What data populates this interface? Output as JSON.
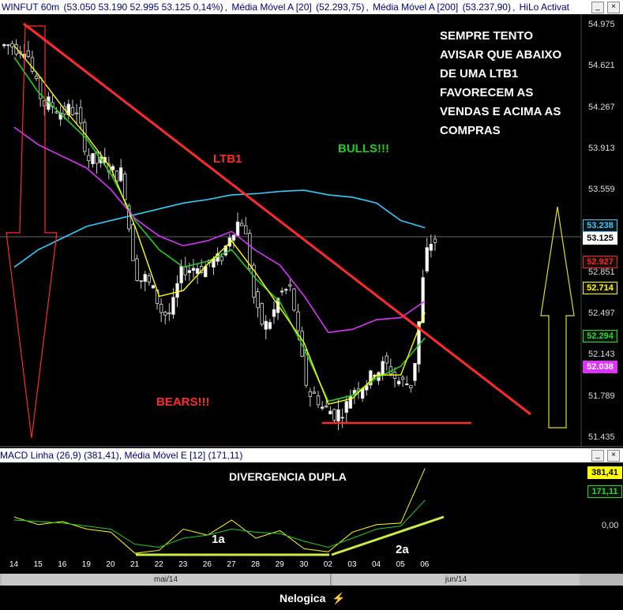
{
  "window": {
    "title_symbol": "WINFUT 60m",
    "title_values": "(53.050  53.190  52.995  53.125  0,14%)",
    "ma20_label": "Média Móvel A [20]",
    "ma20_value": "(52.293,75)",
    "ma200_label": "Média Móvel A [200]",
    "ma200_value": "(53.237,90)",
    "hilo_label": "HiLo Activat",
    "btn_min": "_",
    "btn_close": "×"
  },
  "sub_window": {
    "macd_label": "MACD Linha (26,9)",
    "macd_value": "(381,41)",
    "signal_label": "Média Móvel E [12]",
    "signal_value": "(171,11)",
    "btn_min": "_",
    "btn_close": "×"
  },
  "annotations": {
    "note": "SEMPRE TENTO AVISAR QUE ABAIXO DE UMA LTB1 FAVORECEM AS VENDAS E ACIMA AS COMPRAS",
    "ltb": "LTB1",
    "bulls": "BULLS!!!",
    "bears": "BEARS!!!",
    "divergence": "DIVERGENCIA DUPLA",
    "d1": "1a",
    "d2": "2a"
  },
  "price_axis": [
    "54.975",
    "54.621",
    "54.267",
    "53.913",
    "53.559",
    "52.851",
    "52.497",
    "52.143",
    "51.789",
    "51.435"
  ],
  "price_tags": [
    {
      "value": "53.238",
      "color": "#33ccff"
    },
    {
      "value": "53.125",
      "color": "#ffffff"
    },
    {
      "value": "52.927",
      "color": "#ff2020"
    },
    {
      "value": "52.714",
      "color": "#ffff00"
    },
    {
      "value": "52.294",
      "color": "#22dd22"
    },
    {
      "value": "52.038",
      "color": "#dd33ff"
    }
  ],
  "macd_axis": [
    "0,00"
  ],
  "macd_tags": [
    {
      "value": "381,41",
      "color": "#ffff00"
    },
    {
      "value": "171,11",
      "color": "#22dd22"
    }
  ],
  "x_labels": [
    "14",
    "15",
    "16",
    "19",
    "20",
    "21",
    "22",
    "23",
    "26",
    "27",
    "28",
    "29",
    "30",
    "02",
    "03",
    "04",
    "05",
    "06"
  ],
  "month_labels": [
    "mai/14",
    "jun/14"
  ],
  "footer": {
    "brand": "Nelogica"
  },
  "chart_data": [
    {
      "type": "candlestick",
      "title": "WINFUT 60m",
      "ylim": [
        51435,
        54975
      ],
      "y_ticks": [
        54975,
        54621,
        54267,
        53913,
        53559,
        52851,
        52497,
        52143,
        51789,
        51435
      ],
      "categories": [
        "14",
        "15",
        "16",
        "19",
        "20",
        "21",
        "22",
        "23",
        "26",
        "27",
        "28",
        "29",
        "30",
        "02",
        "03",
        "04",
        "05",
        "06"
      ],
      "series": [
        {
          "name": "Média Móvel A [20]",
          "values": [
            54700,
            54400,
            54200,
            54000,
            53700,
            53300,
            53050,
            52900,
            52950,
            53050,
            52800,
            52600,
            52200,
            51750,
            51800,
            51950,
            52050,
            52294
          ]
        },
        {
          "name": "Média Móvel A [200]",
          "values": [
            52900,
            53050,
            53150,
            53250,
            53300,
            53350,
            53400,
            53450,
            53480,
            53520,
            53530,
            53550,
            53560,
            53520,
            53500,
            53450,
            53300,
            53238
          ]
        },
        {
          "name": "Close",
          "values": [
            54800,
            54300,
            54250,
            53800,
            53700,
            52800,
            52500,
            52900,
            52950,
            53300,
            52400,
            52700,
            51800,
            51650,
            51900,
            52050,
            51900,
            53125
          ]
        }
      ],
      "last": {
        "open": 53050,
        "high": 53190,
        "low": 52995,
        "close": 53125,
        "change": "0,14%"
      }
    },
    {
      "type": "line",
      "title": "MACD Linha (26,9)",
      "categories": [
        "14",
        "15",
        "16",
        "19",
        "20",
        "21",
        "22",
        "23",
        "26",
        "27",
        "28",
        "29",
        "30",
        "02",
        "03",
        "04",
        "05",
        "06"
      ],
      "series": [
        {
          "name": "MACD Linha (26,9)",
          "values": [
            60,
            10,
            30,
            -20,
            -40,
            -180,
            -160,
            -20,
            -60,
            40,
            -80,
            -30,
            -150,
            -170,
            -40,
            10,
            20,
            381.41
          ]
        },
        {
          "name": "Média Móvel E [12]",
          "values": [
            40,
            30,
            20,
            0,
            -20,
            -120,
            -140,
            -80,
            -60,
            -20,
            -40,
            -50,
            -100,
            -140,
            -80,
            -20,
            0,
            171.11
          ]
        }
      ],
      "y_ticks": [
        0
      ]
    }
  ]
}
